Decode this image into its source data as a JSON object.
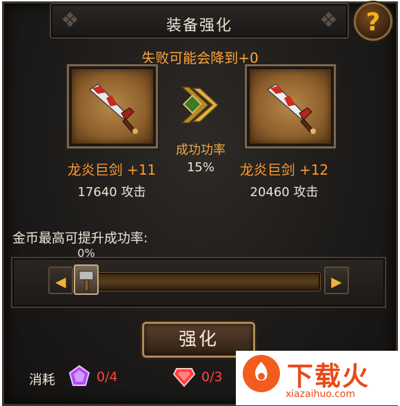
{
  "header": {
    "title": "装备强化",
    "help_label": "?"
  },
  "warning_text": "失败可能会降到+0",
  "current_item": {
    "name": "龙炎巨剑 +11",
    "stat": "17640 攻击"
  },
  "target_item": {
    "name": "龙炎巨剑 +12",
    "stat": "20460 攻击"
  },
  "success_rate": {
    "label": "成功功率",
    "value": "15%"
  },
  "gold_boost": {
    "label": "金币最高可提升成功率:",
    "percent_text": "0%",
    "value": 0
  },
  "enhance_button_label": "强化",
  "cost": {
    "label": "消耗",
    "items": [
      {
        "icon": "purple-gem-icon",
        "count": "0/4",
        "color": "#b04cff"
      },
      {
        "icon": "red-gem-icon",
        "count": "0/3",
        "color": "#ff3a3a"
      }
    ]
  },
  "watermark": {
    "text": "下载火",
    "domain": "xiazaihuo.com"
  },
  "colors": {
    "accent": "#ffa43a",
    "stat_text": "#ece4d6",
    "deficit": "#ff4646"
  }
}
